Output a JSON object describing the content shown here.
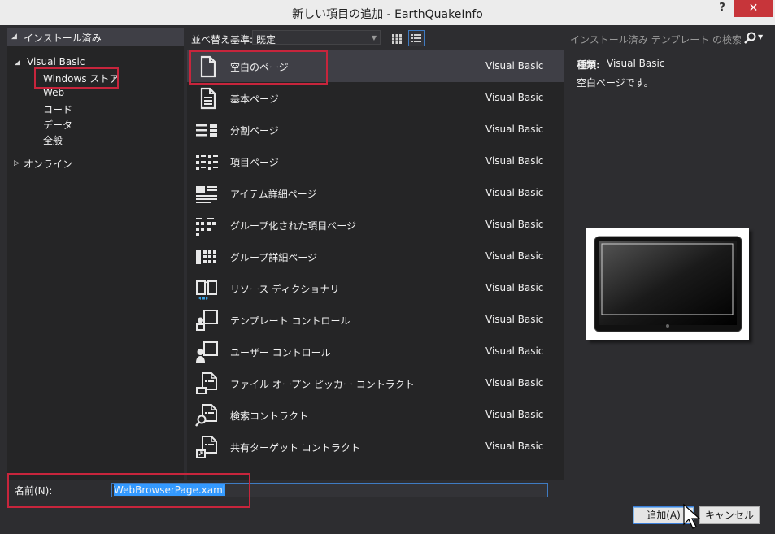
{
  "window": {
    "title": "新しい項目の追加 - EarthQuakeInfo",
    "help": "?",
    "close": "✕"
  },
  "left_panel": {
    "header": "インストール済み",
    "tree": [
      {
        "label": "Visual Basic"
      },
      {
        "label": "Windows ストア"
      },
      {
        "label": "Web"
      },
      {
        "label": "コード"
      },
      {
        "label": "データ"
      },
      {
        "label": "全般"
      },
      {
        "label": "オンライン"
      }
    ]
  },
  "toolbar": {
    "sort_label": "並べ替え基準:",
    "sort_value": "既定",
    "view_icons": [
      "grid-view-icon",
      "list-view-icon"
    ]
  },
  "search": {
    "placeholder": "インストール済み テンプレート の検索 (Ctrl",
    "icon": "search-icon"
  },
  "templates": [
    {
      "name": "空白のページ",
      "lang": "Visual Basic",
      "icon": "blank-page-icon"
    },
    {
      "name": "基本ページ",
      "lang": "Visual Basic",
      "icon": "basic-page-icon"
    },
    {
      "name": "分割ページ",
      "lang": "Visual Basic",
      "icon": "split-page-icon"
    },
    {
      "name": "項目ページ",
      "lang": "Visual Basic",
      "icon": "items-page-icon"
    },
    {
      "name": "アイテム詳細ページ",
      "lang": "Visual Basic",
      "icon": "item-detail-page-icon"
    },
    {
      "name": "グループ化された項目ページ",
      "lang": "Visual Basic",
      "icon": "grouped-items-page-icon"
    },
    {
      "name": "グループ詳細ページ",
      "lang": "Visual Basic",
      "icon": "group-detail-page-icon"
    },
    {
      "name": "リソース ディクショナリ",
      "lang": "Visual Basic",
      "icon": "resource-dictionary-icon"
    },
    {
      "name": "テンプレート コントロール",
      "lang": "Visual Basic",
      "icon": "templated-control-icon"
    },
    {
      "name": "ユーザー コントロール",
      "lang": "Visual Basic",
      "icon": "user-control-icon"
    },
    {
      "name": "ファイル オープン ピッカー コントラクト",
      "lang": "Visual Basic",
      "icon": "file-picker-contract-icon"
    },
    {
      "name": "検索コントラクト",
      "lang": "Visual Basic",
      "icon": "search-contract-icon"
    },
    {
      "name": "共有ターゲット コントラクト",
      "lang": "Visual Basic",
      "icon": "share-target-contract-icon"
    }
  ],
  "details": {
    "type_label": "種類:",
    "type_value": "Visual Basic",
    "description": "空白ページです。",
    "preview": "tablet-preview-image"
  },
  "name_field": {
    "label": "名前(N):",
    "value": "WebBrowserPage.xaml"
  },
  "buttons": {
    "add": "追加(A)",
    "cancel": "キャンセル"
  },
  "colors": {
    "accent": "#3f7bc2",
    "highlight_box": "#c7253c",
    "close_button": "#c7353a",
    "background": "#2d2d30",
    "panel": "#252526"
  }
}
